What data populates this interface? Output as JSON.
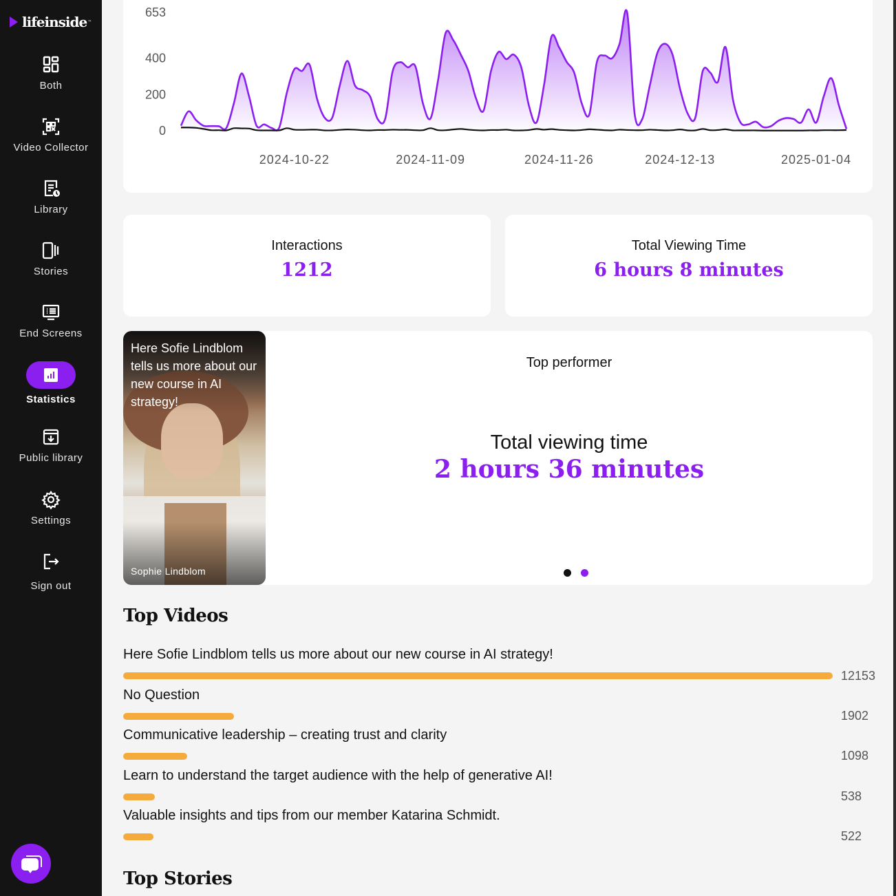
{
  "app": {
    "brand": "lifeinside",
    "trademark": "™"
  },
  "sidebar": {
    "items": [
      {
        "label": "Both",
        "icon": "grid-layout-icon",
        "active": false
      },
      {
        "label": "Video Collector",
        "icon": "qr-code-icon",
        "active": false
      },
      {
        "label": "Library",
        "icon": "document-clock-icon",
        "active": false
      },
      {
        "label": "Stories",
        "icon": "stories-icon",
        "active": false
      },
      {
        "label": "End Screens",
        "icon": "monitor-list-icon",
        "active": false
      },
      {
        "label": "Statistics",
        "icon": "bar-chart-icon",
        "active": true
      },
      {
        "label": "Public library",
        "icon": "archive-download-icon",
        "active": false
      },
      {
        "label": "Settings",
        "icon": "gear-icon",
        "active": false
      },
      {
        "label": "Sign out",
        "icon": "sign-out-icon",
        "active": false
      }
    ],
    "chat_icon": "chat-bubbles-icon"
  },
  "colors": {
    "accent": "#8b1ff0",
    "bar": "#f5ab3c",
    "sidebar_bg": "#141414",
    "page_bg": "#f4f4f4",
    "secondary_line": "#111111"
  },
  "chart_data": {
    "type": "area",
    "title": "",
    "xlabel": "",
    "ylabel": "",
    "ylim": [
      0,
      653
    ],
    "y_ticks": [
      0,
      200,
      400,
      653
    ],
    "x_tick_labels": [
      "2024-10-22",
      "2024-11-09",
      "2024-11-26",
      "2024-12-13",
      "2025-01-04"
    ],
    "x_tick_indices": [
      15,
      33,
      50,
      66,
      84
    ],
    "grid": false,
    "legend": "none",
    "series": [
      {
        "name": "primary",
        "color": "#8b1ff0",
        "fill": true,
        "values": [
          28,
          107,
          58,
          27,
          26,
          25,
          15,
          152,
          316,
          190,
          27,
          35,
          15,
          18,
          210,
          340,
          330,
          365,
          175,
          72,
          72,
          250,
          385,
          250,
          225,
          190,
          65,
          65,
          330,
          378,
          350,
          355,
          150,
          68,
          280,
          540,
          500,
          420,
          330,
          180,
          110,
          330,
          435,
          395,
          420,
          350,
          140,
          45,
          250,
          520,
          460,
          380,
          320,
          150,
          90,
          380,
          415,
          400,
          480,
          653,
          90,
          65,
          250,
          430,
          480,
          420,
          230,
          95,
          70,
          330,
          320,
          270,
          462,
          170,
          45,
          35,
          50,
          20,
          25,
          55,
          70,
          65,
          45,
          118,
          45,
          190,
          290,
          140,
          10
        ]
      },
      {
        "name": "secondary",
        "color": "#111111",
        "fill": false,
        "values": [
          18,
          18,
          16,
          10,
          3,
          3,
          2,
          14,
          13,
          12,
          3,
          2,
          2,
          2,
          14,
          6,
          5,
          6,
          6,
          2,
          2,
          5,
          7,
          6,
          3,
          2,
          4,
          4,
          6,
          5,
          5,
          3,
          3,
          14,
          3,
          3,
          7,
          10,
          6,
          3,
          2,
          4,
          4,
          6,
          2,
          2,
          4,
          10,
          6,
          9,
          5,
          3,
          2,
          4,
          8,
          6,
          3,
          2,
          6,
          4,
          3,
          3,
          6,
          4,
          2,
          3,
          7,
          2,
          2,
          10,
          3,
          4,
          8,
          2,
          2,
          2,
          2,
          1,
          1,
          1,
          1,
          1,
          1,
          2,
          2,
          3,
          3,
          3,
          4
        ]
      }
    ]
  },
  "stats": {
    "interactions": {
      "label": "Interactions",
      "value": "1212"
    },
    "viewing_time": {
      "label": "Total Viewing Time",
      "value": "6 hours 8 minutes"
    }
  },
  "top_performer": {
    "title": "Top performer",
    "video_caption": "Here Sofie Lindblom tells us more about our new course in AI strategy!",
    "video_author": "Sophie Lindblom",
    "metric_label": "Total viewing time",
    "metric_value": "2 hours 36 minutes",
    "slides": 2,
    "active_slide": 2
  },
  "top_videos": {
    "title": "Top Videos",
    "items": [
      {
        "title": "Here Sofie Lindblom tells us more about our new course in AI strategy!",
        "count": 12153
      },
      {
        "title": "No Question",
        "count": 1902
      },
      {
        "title": "Communicative leadership – creating trust and clarity",
        "count": 1098
      },
      {
        "title": "Learn to understand the target audience with the help of generative AI!",
        "count": 538
      },
      {
        "title": "Valuable insights and tips from our member Katarina Schmidt.",
        "count": 522
      }
    ]
  },
  "top_stories": {
    "title": "Top Stories"
  }
}
